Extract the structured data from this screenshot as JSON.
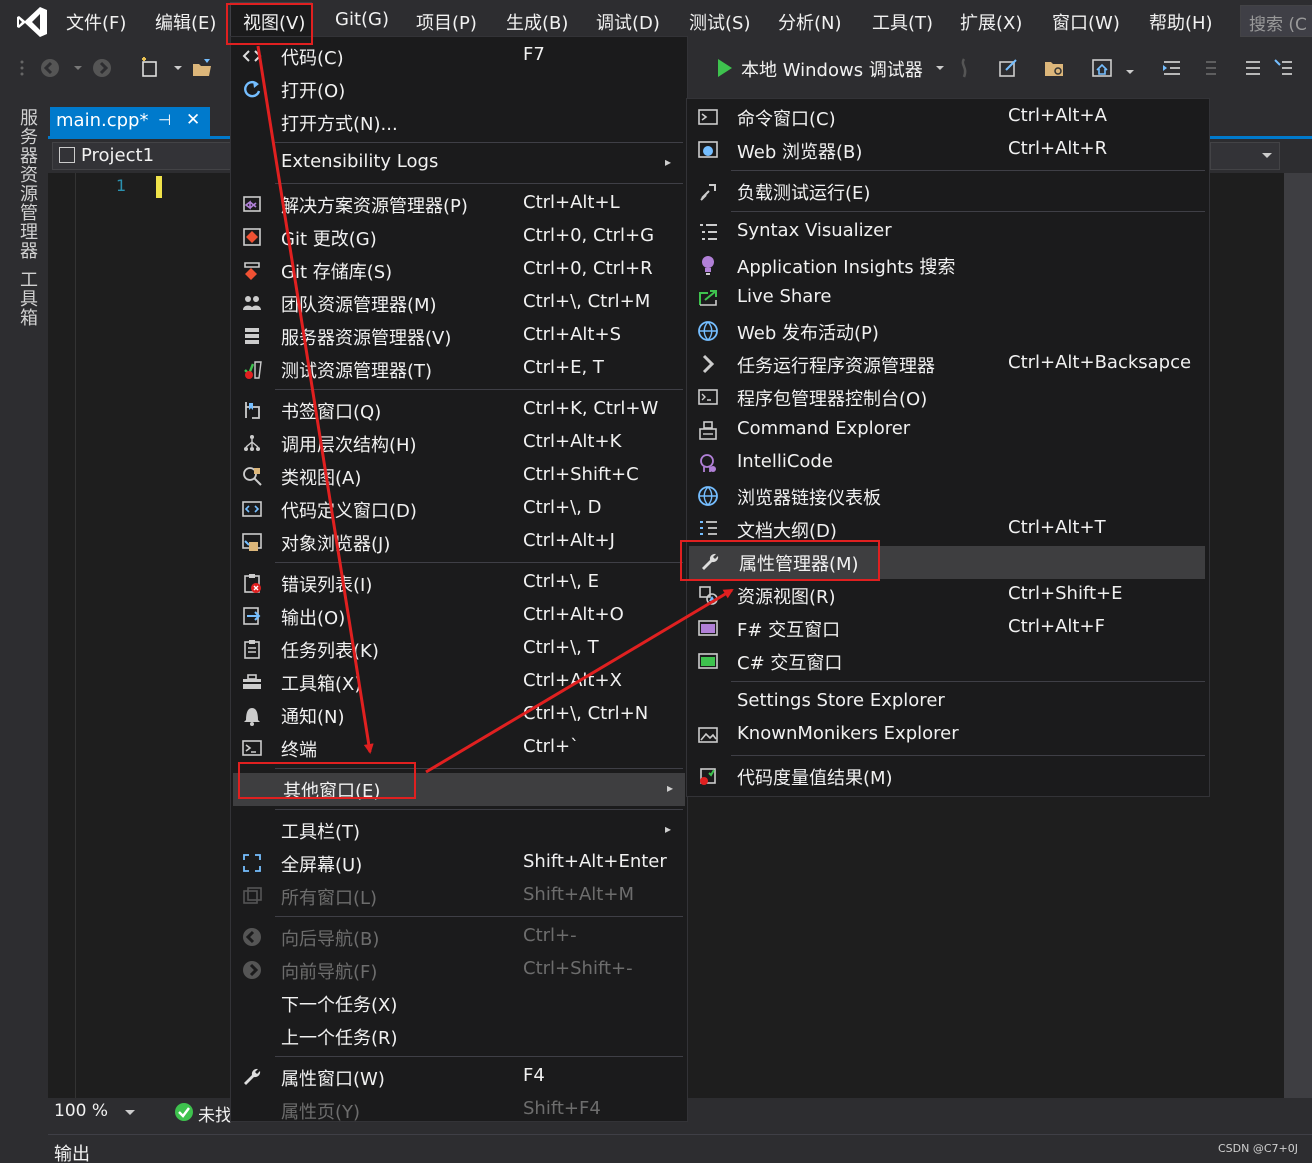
{
  "menubar": {
    "items": [
      "文件(F)",
      "编辑(E)",
      "视图(V)",
      "Git(G)",
      "项目(P)",
      "生成(B)",
      "调试(D)",
      "测试(S)",
      "分析(N)",
      "工具(T)",
      "扩展(X)",
      "窗口(W)",
      "帮助(H)"
    ],
    "search_placeholder": "搜索 (C"
  },
  "toolbar": {
    "debugger_label": "本地 Windows 调试器"
  },
  "left_rail": {
    "tabs": [
      "服务器资源管理器",
      "工具箱"
    ]
  },
  "editor": {
    "tab_label": "main.cpp*",
    "tab_pin": "⊣",
    "tab_close": "✕",
    "project": "Project1",
    "line_number": "1"
  },
  "status": {
    "zoom": "100 %",
    "issues": "未找",
    "output": "输出",
    "watermark": "CSDN @C7+0J"
  },
  "view_menu": {
    "items": [
      {
        "label": "代码(C)",
        "shortcut": "F7",
        "icon": "code-icon"
      },
      {
        "label": "打开(O)",
        "shortcut": "",
        "icon": "open-icon"
      },
      {
        "label": "打开方式(N)...",
        "shortcut": "",
        "icon": ""
      },
      {
        "label": "Extensibility Logs",
        "shortcut": "",
        "icon": "",
        "submenu": true
      },
      {
        "label": "解决方案资源管理器(P)",
        "shortcut": "Ctrl+Alt+L",
        "icon": "solution-explorer-icon"
      },
      {
        "label": "Git 更改(G)",
        "shortcut": "Ctrl+0, Ctrl+G",
        "icon": "git-changes-icon"
      },
      {
        "label": "Git 存储库(S)",
        "shortcut": "Ctrl+0, Ctrl+R",
        "icon": "git-repo-icon"
      },
      {
        "label": "团队资源管理器(M)",
        "shortcut": "Ctrl+\\, Ctrl+M",
        "icon": "team-explorer-icon"
      },
      {
        "label": "服务器资源管理器(V)",
        "shortcut": "Ctrl+Alt+S",
        "icon": "server-explorer-icon"
      },
      {
        "label": "测试资源管理器(T)",
        "shortcut": "Ctrl+E, T",
        "icon": "test-explorer-icon"
      },
      {
        "label": "书签窗口(Q)",
        "shortcut": "Ctrl+K, Ctrl+W",
        "icon": "bookmark-icon"
      },
      {
        "label": "调用层次结构(H)",
        "shortcut": "Ctrl+Alt+K",
        "icon": "call-hierarchy-icon"
      },
      {
        "label": "类视图(A)",
        "shortcut": "Ctrl+Shift+C",
        "icon": "class-view-icon"
      },
      {
        "label": "代码定义窗口(D)",
        "shortcut": "Ctrl+\\, D",
        "icon": "code-definition-icon"
      },
      {
        "label": "对象浏览器(J)",
        "shortcut": "Ctrl+Alt+J",
        "icon": "object-browser-icon"
      },
      {
        "label": "错误列表(I)",
        "shortcut": "Ctrl+\\, E",
        "icon": "error-list-icon"
      },
      {
        "label": "输出(O)",
        "shortcut": "Ctrl+Alt+O",
        "icon": "output-icon"
      },
      {
        "label": "任务列表(K)",
        "shortcut": "Ctrl+\\, T",
        "icon": "task-list-icon"
      },
      {
        "label": "工具箱(X)",
        "shortcut": "Ctrl+Alt+X",
        "icon": "toolbox-icon"
      },
      {
        "label": "通知(N)",
        "shortcut": "Ctrl+\\, Ctrl+N",
        "icon": "bell-icon"
      },
      {
        "label": "终端",
        "shortcut": "Ctrl+`",
        "icon": "terminal-icon"
      },
      {
        "label": "其他窗口(E)",
        "shortcut": "",
        "icon": "",
        "submenu": true
      },
      {
        "label": "工具栏(T)",
        "shortcut": "",
        "icon": "",
        "submenu": true
      },
      {
        "label": "全屏幕(U)",
        "shortcut": "Shift+Alt+Enter",
        "icon": "fullscreen-icon"
      },
      {
        "label": "所有窗口(L)",
        "shortcut": "Shift+Alt+M",
        "icon": "all-windows-icon",
        "disabled": true
      },
      {
        "label": "向后导航(B)",
        "shortcut": "Ctrl+-",
        "icon": "back-icon",
        "disabled": true
      },
      {
        "label": "向前导航(F)",
        "shortcut": "Ctrl+Shift+-",
        "icon": "forward-icon",
        "disabled": true
      },
      {
        "label": "下一个任务(X)",
        "shortcut": "",
        "icon": ""
      },
      {
        "label": "上一个任务(R)",
        "shortcut": "",
        "icon": ""
      },
      {
        "label": "属性窗口(W)",
        "shortcut": "F4",
        "icon": "wrench-icon"
      },
      {
        "label": "属性页(Y)",
        "shortcut": "Shift+F4",
        "icon": "",
        "disabled": true
      }
    ]
  },
  "other_menu": {
    "items": [
      {
        "label": "命令窗口(C)",
        "shortcut": "Ctrl+Alt+A",
        "icon": "command-window-icon"
      },
      {
        "label": "Web 浏览器(B)",
        "shortcut": "Ctrl+Alt+R",
        "icon": "web-browser-icon"
      },
      {
        "label": "负载测试运行(E)",
        "shortcut": "",
        "icon": "load-test-icon"
      },
      {
        "label": "Syntax Visualizer",
        "shortcut": "",
        "icon": "syntax-visualizer-icon"
      },
      {
        "label": "Application Insights 搜索",
        "shortcut": "",
        "icon": "lightbulb-icon"
      },
      {
        "label": "Live Share",
        "shortcut": "",
        "icon": "live-share-icon"
      },
      {
        "label": "Web 发布活动(P)",
        "shortcut": "",
        "icon": "globe-icon"
      },
      {
        "label": "任务运行程序资源管理器",
        "shortcut": "Ctrl+Alt+Backsapce",
        "icon": "chevron-right-icon"
      },
      {
        "label": "程序包管理器控制台(O)",
        "shortcut": "",
        "icon": "console-icon"
      },
      {
        "label": "Command Explorer",
        "shortcut": "",
        "icon": "command-explorer-icon"
      },
      {
        "label": "IntelliCode",
        "shortcut": "",
        "icon": "intellicode-icon"
      },
      {
        "label": "浏览器链接仪表板",
        "shortcut": "",
        "icon": "browser-link-icon"
      },
      {
        "label": "文档大纲(D)",
        "shortcut": "Ctrl+Alt+T",
        "icon": "document-outline-icon"
      },
      {
        "label": "属性管理器(M)",
        "shortcut": "",
        "icon": "wrench-icon"
      },
      {
        "label": "资源视图(R)",
        "shortcut": "Ctrl+Shift+E",
        "icon": "resource-view-icon"
      },
      {
        "label": "F# 交互窗口",
        "shortcut": "Ctrl+Alt+F",
        "icon": "fsharp-interactive-icon"
      },
      {
        "label": "C# 交互窗口",
        "shortcut": "",
        "icon": "csharp-interactive-icon"
      },
      {
        "label": "Settings Store Explorer",
        "shortcut": "",
        "icon": ""
      },
      {
        "label": "KnownMonikers Explorer",
        "shortcut": "",
        "icon": "image-icon"
      },
      {
        "label": "代码度量值结果(M)",
        "shortcut": "",
        "icon": "code-metrics-icon"
      }
    ]
  },
  "colors": {
    "accent": "#007acc",
    "annotation": "#e02020"
  }
}
